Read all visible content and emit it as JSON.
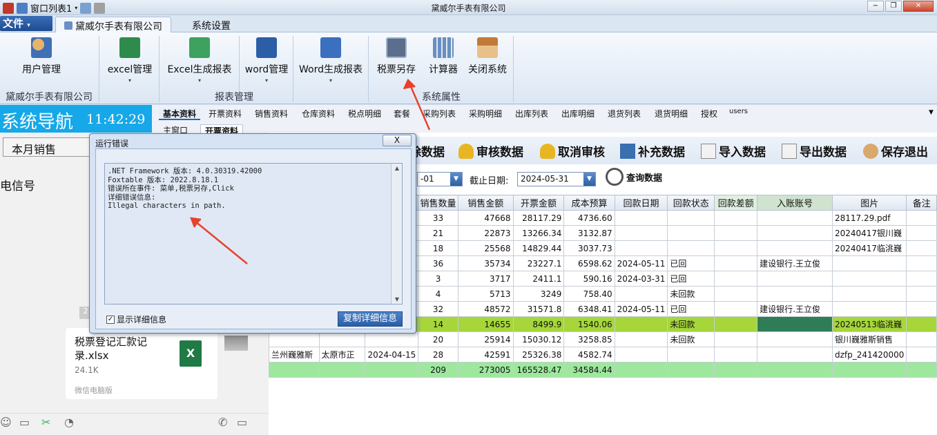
{
  "titlebar": {
    "quick_access_label": "窗口列表1",
    "app_title": "黛威尔手表有限公司",
    "minimize": "−",
    "restore": "❐",
    "close": "✕"
  },
  "ribbon_tabs": {
    "file": "文件",
    "company": "黛威尔手表有限公司",
    "settings": "系统设置"
  },
  "ribbon": {
    "buttons": [
      {
        "label": "用户管理",
        "icon": "users-icon"
      },
      {
        "label": "excel管理",
        "icon": "excel-icon"
      },
      {
        "label": "Excel生成报表",
        "icon": "excel-report-icon"
      },
      {
        "label": "word管理",
        "icon": "word-icon"
      },
      {
        "label": "Word生成报表",
        "icon": "word-report-icon"
      },
      {
        "label": "税票另存",
        "icon": "tax-ticket-icon"
      },
      {
        "label": "计算器",
        "icon": "calculator-icon"
      },
      {
        "label": "关闭系统",
        "icon": "home-icon"
      }
    ],
    "groups": {
      "company": "黛威尔手表有限公司",
      "reports": "报表管理",
      "system": "系统属性"
    }
  },
  "nav": {
    "title": "系统导航",
    "time": "11:42:29",
    "sales_select": "本月销售",
    "telecom": "电信号"
  },
  "main_tabs": [
    "基本资料",
    "开票资料",
    "销售资料",
    "仓库资料",
    "税点明细",
    "套餐",
    "采购列表",
    "采购明细",
    "出库列表",
    "出库明细",
    "退货列表",
    "退货明细",
    "授权",
    "users"
  ],
  "sub_tabs": [
    "主窗口",
    "开票资料"
  ],
  "toolbar": [
    "除数据",
    "审核数据",
    "取消审核",
    "补充数据",
    "导入数据",
    "导出数据",
    "保存退出"
  ],
  "filter": {
    "start_value": "-01",
    "end_label": "截止日期:",
    "end_value": "2024-05-31",
    "query": "查询数据"
  },
  "table": {
    "headers": [
      "",
      "",
      "",
      "销售数量",
      "销售金额",
      "开票金额",
      "成本预算",
      "回款日期",
      "回款状态",
      "回款差额",
      "入账账号",
      "图片",
      "备注"
    ],
    "rows": [
      [
        "",
        "",
        "",
        "33",
        "47668",
        "28117.29",
        "4736.60",
        "",
        "",
        "",
        "",
        "28117.29.pdf",
        ""
      ],
      [
        "",
        "",
        "",
        "21",
        "22873",
        "13266.34",
        "3132.87",
        "",
        "",
        "",
        "",
        "20240417银川巍",
        ""
      ],
      [
        "",
        "",
        "",
        "18",
        "25568",
        "14829.44",
        "3037.73",
        "",
        "",
        "",
        "",
        "20240417临洮巍",
        ""
      ],
      [
        "",
        "",
        "",
        "36",
        "35734",
        "23227.1",
        "6598.62",
        "2024-05-11",
        "已回",
        "",
        "建设银行.王立俊",
        "",
        ""
      ],
      [
        "",
        "",
        "",
        "3",
        "3717",
        "2411.1",
        "590.16",
        "2024-03-31",
        "已回",
        "",
        "",
        "",
        ""
      ],
      [
        "",
        "",
        "",
        "4",
        "5713",
        "3249",
        "758.40",
        "",
        "未回款",
        "",
        "",
        "",
        ""
      ],
      [
        "",
        "",
        "",
        "32",
        "48572",
        "31571.8",
        "6348.41",
        "2024-05-11",
        "已回",
        "",
        "建设银行.王立俊",
        "",
        ""
      ],
      [
        "",
        "",
        "",
        "14",
        "14655",
        "8499.9",
        "1540.06",
        "",
        "未回款",
        "",
        "",
        "20240513临洮巍",
        ""
      ],
      [
        "",
        "",
        "",
        "20",
        "25914",
        "15030.12",
        "3258.85",
        "",
        "未回款",
        "",
        "",
        "银川巍雅斯销售",
        ""
      ],
      [
        "兰州巍雅斯",
        "太原市正",
        "2024-04-15",
        "28",
        "42591",
        "25326.38",
        "4582.74",
        "",
        "",
        "",
        "",
        "dzfp_241420000",
        ""
      ]
    ],
    "summary": [
      "",
      "",
      "",
      "209",
      "273005",
      "165528.47",
      "34584.44",
      "",
      "",
      "",
      "",
      "",
      ""
    ]
  },
  "dialog": {
    "title": "运行错误",
    "close": "X",
    "lines": [
      ".NET Framework 版本: 4.0.30319.42000",
      "Foxtable 版本: 2022.8.18.1",
      "错误所在事件: 菜单,税票另存,Click",
      "详细错误信息:",
      "Illegal characters in path."
    ],
    "show_details": "显示详细信息",
    "copy_details": "复制详细信息"
  },
  "chat": {
    "badge": "2",
    "file_name": "税票登记汇款记录.xlsx",
    "file_size": "24.1K",
    "source": "微信电脑版",
    "xl": "X"
  },
  "colors": {
    "accent": "#16a8e8",
    "selected_row": "#a6d63a",
    "summary_row": "#9ee89e",
    "arrow": "#e8412b"
  }
}
